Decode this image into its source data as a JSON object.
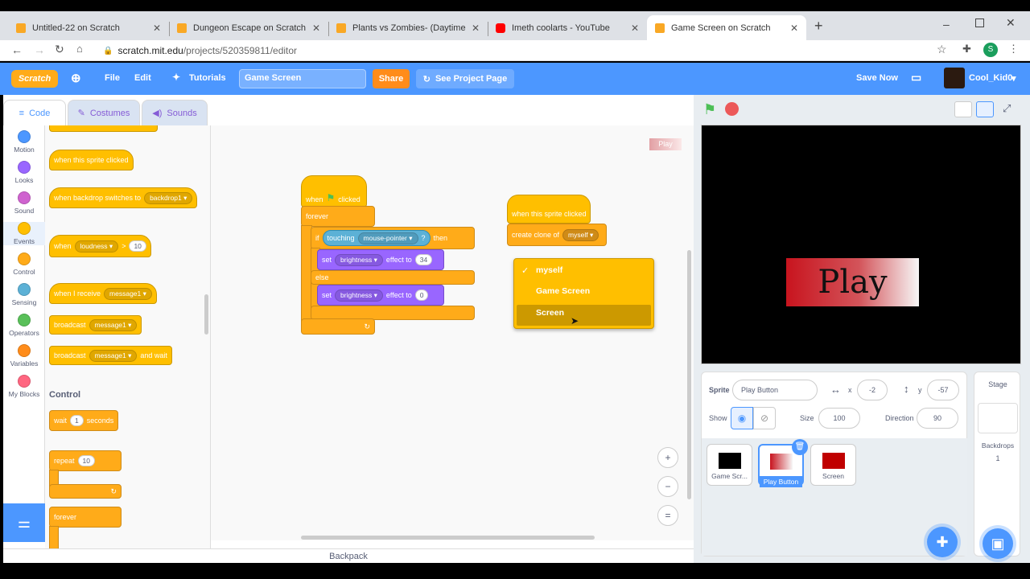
{
  "browser": {
    "tabs": [
      {
        "title": "Untitled-22 on Scratch"
      },
      {
        "title": "Dungeon Escape on Scratch"
      },
      {
        "title": "Plants vs Zombies- (Daytime Adv"
      },
      {
        "title": "Imeth coolarts - YouTube"
      },
      {
        "title": "Game Screen on Scratch"
      }
    ],
    "url_host": "scratch.mit.edu",
    "url_path": "/projects/520359811/editor",
    "profile_initial": "S"
  },
  "menubar": {
    "logo": "Scratch",
    "file": "File",
    "edit": "Edit",
    "tutorials": "Tutorials",
    "project_title": "Game Screen",
    "share": "Share",
    "see_project": "See Project Page",
    "save_now": "Save Now",
    "username": "Cool_Kid0"
  },
  "editor_tabs": {
    "code": "Code",
    "costumes": "Costumes",
    "sounds": "Sounds"
  },
  "categories": [
    {
      "label": "Motion",
      "color": "#4c97ff"
    },
    {
      "label": "Looks",
      "color": "#9966ff"
    },
    {
      "label": "Sound",
      "color": "#cf63cf"
    },
    {
      "label": "Events",
      "color": "#ffbf00"
    },
    {
      "label": "Control",
      "color": "#ffab19"
    },
    {
      "label": "Sensing",
      "color": "#5cb1d6"
    },
    {
      "label": "Operators",
      "color": "#59c059"
    },
    {
      "label": "Variables",
      "color": "#ff8c1a"
    },
    {
      "label": "My Blocks",
      "color": "#ff6680"
    }
  ],
  "palette": {
    "when_sprite_clicked": "when this sprite clicked",
    "when_backdrop": "when backdrop switches to",
    "backdrop1": "backdrop1",
    "when": "when",
    "loudness": "loudness",
    "gt": ">",
    "ten": "10",
    "when_receive": "when I receive",
    "message1": "message1",
    "broadcast": "broadcast",
    "broadcast_wait": "and wait",
    "control_heading": "Control",
    "wait": "wait",
    "one": "1",
    "seconds": "seconds",
    "repeat": "repeat",
    "forever": "forever"
  },
  "script1": {
    "when": "when",
    "clicked": "clicked",
    "forever": "forever",
    "if": "if",
    "touching": "touching",
    "mouse_pointer": "mouse-pointer",
    "q": "?",
    "then": "then",
    "set": "set",
    "brightness": "brightness",
    "effect_to": "effect to",
    "val1": "34",
    "else": "else",
    "val2": "0"
  },
  "script2": {
    "hat": "when this sprite clicked",
    "create_clone": "create clone of",
    "myself": "myself"
  },
  "dropdown": {
    "items": [
      "myself",
      "Game Screen",
      "Screen"
    ],
    "checked": "myself"
  },
  "workspace_mini": "Play",
  "stage": {
    "play_text": "Play"
  },
  "sprite_info": {
    "sprite_label": "Sprite",
    "sprite_name": "Play Button",
    "x_label": "x",
    "x": "-2",
    "y_label": "y",
    "y": "-57",
    "show_label": "Show",
    "size_label": "Size",
    "size": "100",
    "direction_label": "Direction",
    "direction": "90"
  },
  "sprites": [
    {
      "name": "Game Scr...",
      "color": "#000000"
    },
    {
      "name": "Play Button",
      "color": "#c8141e"
    },
    {
      "name": "Screen",
      "color": "#c00000"
    }
  ],
  "stage_panel": {
    "title": "Stage",
    "backdrops_label": "Backdrops",
    "backdrops_count": "1"
  },
  "backpack": "Backpack"
}
